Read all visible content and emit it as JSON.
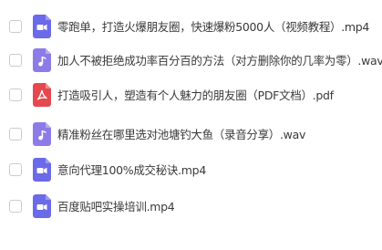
{
  "files": [
    {
      "name": "零跑单，打造火爆朋友圈，快速爆粉5000人（视频教程）.mp4",
      "icon": "video-file-icon",
      "color": "#6b6ae8"
    },
    {
      "name": "加人不被拒绝成功率百分百的方法（对方删除你的几率为零）.wav",
      "icon": "audio-file-icon",
      "color": "#8d7be8"
    },
    {
      "name": "打造吸引人，塑造有个人魅力的朋友圈（PDF文档）.pdf",
      "icon": "pdf-file-icon",
      "color": "#e5484d"
    },
    {
      "name": "精准粉丝在哪里选对池塘钓大鱼（录音分享）.wav",
      "icon": "audio-file-icon",
      "color": "#8d7be8"
    },
    {
      "name": "意向代理100%成交秘诀.mp4",
      "icon": "video-file-icon",
      "color": "#6b6ae8"
    },
    {
      "name": "百度贴吧实操培训.mp4",
      "icon": "video-file-icon",
      "color": "#6b6ae8"
    }
  ]
}
